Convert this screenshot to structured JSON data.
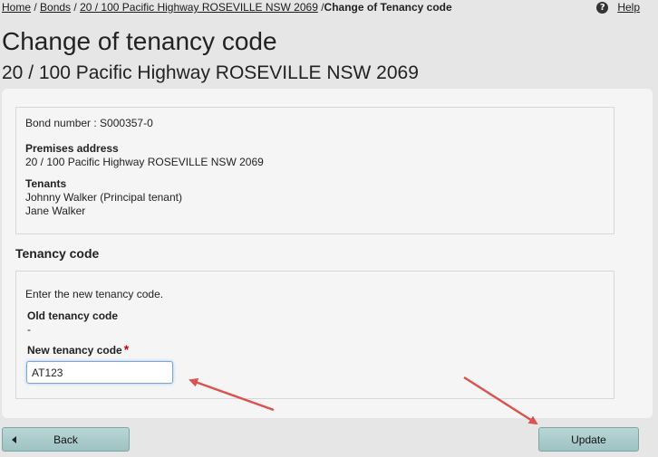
{
  "breadcrumb": {
    "home": "Home",
    "sep1": " / ",
    "bonds": "Bonds",
    "sep2": " / ",
    "address_link": "20 / 100 Pacific Highway ROSEVILLE NSW 2069",
    "sep3": " /",
    "current": "Change of Tenancy code"
  },
  "help": {
    "icon": "question-icon",
    "label": "Help"
  },
  "page": {
    "title": "Change of tenancy code",
    "subtitle": "20 / 100 Pacific Highway ROSEVILLE NSW 2069"
  },
  "info": {
    "bond_number": "Bond number : S000357-0",
    "premises_label": "Premises address",
    "premises_value": "20 / 100 Pacific Highway ROSEVILLE NSW 2069",
    "tenants_label": "Tenants",
    "tenants": [
      "Johnny Walker (Principal tenant)",
      "Jane Walker"
    ]
  },
  "tenancy": {
    "section_title": "Tenancy code",
    "instruction": "Enter the new tenancy code.",
    "old_label": "Old tenancy code",
    "old_value": "-",
    "new_label": "New tenancy code",
    "required_mark": "*",
    "new_value": "AT123"
  },
  "buttons": {
    "back": "Back",
    "update": "Update"
  },
  "colors": {
    "annotation_arrow": "#d9534f",
    "button": "#a9cccc"
  }
}
